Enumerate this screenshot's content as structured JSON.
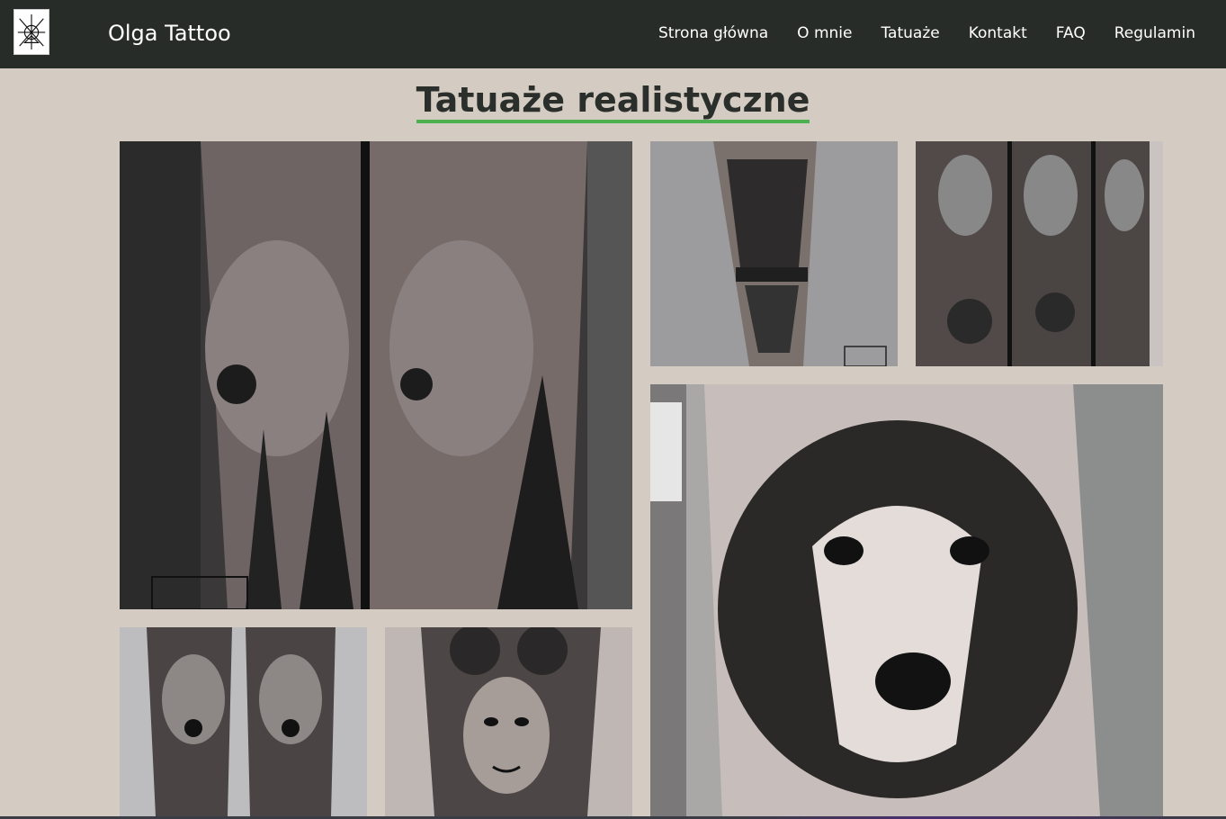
{
  "header": {
    "brand": "Olga Tattoo",
    "nav": [
      "Strona główna",
      "O mnie",
      "Tatuaże",
      "Kontakt",
      "FAQ",
      "Regulamin"
    ]
  },
  "page": {
    "title": "Tatuaże realistyczne",
    "accent_color": "#4caf50",
    "background_color": "#d4ccc2",
    "navbar_color": "#282c28"
  },
  "gallery": [
    {
      "subject": "wolf-forest-sleeve",
      "selected": false
    },
    {
      "subject": "wolf-forearm-reflection",
      "selected": false
    },
    {
      "subject": "wolf-sleeve-triptych",
      "selected": false
    },
    {
      "subject": "husky-shoulder",
      "selected": false
    },
    {
      "subject": "wolf-calf-pair",
      "selected": false
    },
    {
      "subject": "woman-roses-thigh",
      "selected": false
    }
  ]
}
